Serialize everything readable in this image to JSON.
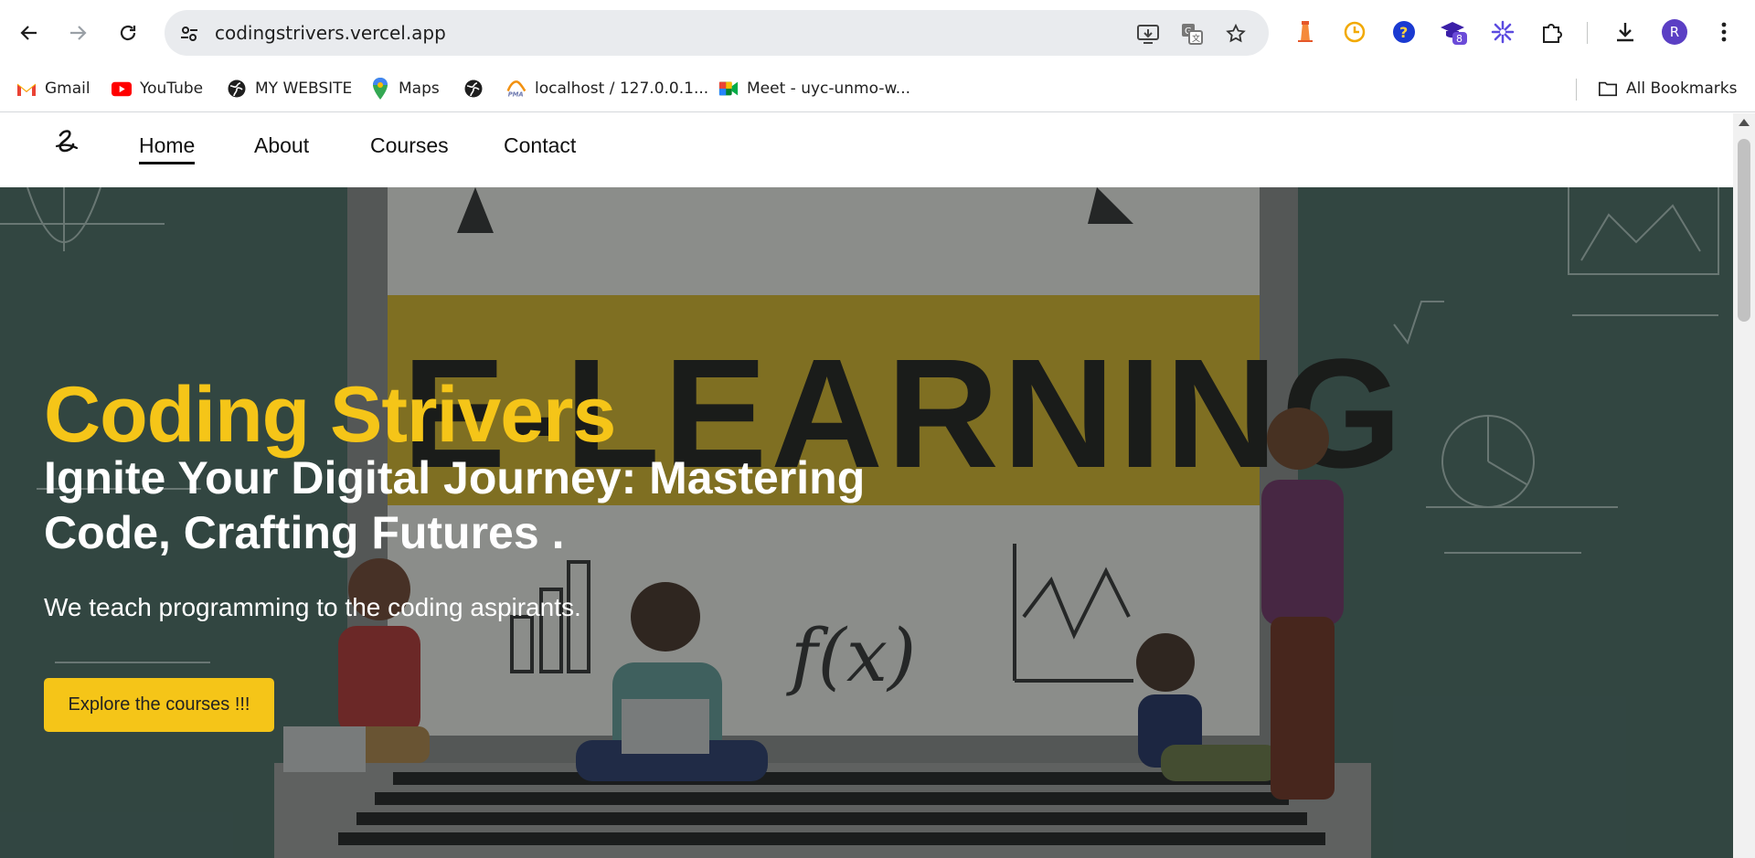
{
  "browser": {
    "url": "codingstrivers.vercel.app",
    "profile_initial": "R",
    "extension_badge": "8",
    "bookmarks": [
      {
        "label": "Gmail",
        "icon": "gmail-icon"
      },
      {
        "label": "YouTube",
        "icon": "youtube-icon"
      },
      {
        "label": "MY WEBSITE",
        "icon": "globe-icon"
      },
      {
        "label": "Maps",
        "icon": "maps-icon"
      },
      {
        "label": "",
        "icon": "globe-icon"
      },
      {
        "label": "localhost / 127.0.0.1...",
        "icon": "phpmyadmin-icon"
      },
      {
        "label": "Meet - uyc-unmo-w...",
        "icon": "meet-icon"
      }
    ],
    "all_bookmarks": "All Bookmarks"
  },
  "site": {
    "nav": [
      "Home",
      "About",
      "Courses",
      "Contact"
    ],
    "active_nav": "Home",
    "hero": {
      "title": "Coding Strivers",
      "subtitle": "Ignite Your Digital Journey: Mastering Code, Crafting Futures .",
      "description": "We teach programming to the coding aspirants.",
      "button": "Explore the courses !!!",
      "banner_word": "E-LEARNING"
    }
  },
  "colors": {
    "accent": "#f5c518",
    "hero_bg": "#3d5650",
    "profile": "#5b3fc4"
  }
}
